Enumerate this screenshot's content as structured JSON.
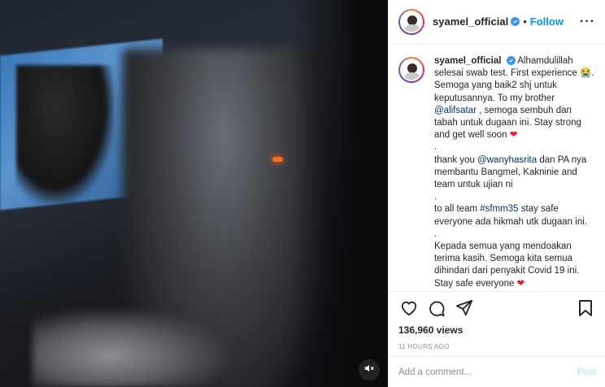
{
  "post": {
    "username": "syamel_official",
    "follow_label": "Follow",
    "more_icon": "more-horizontal-icon",
    "dot": "•"
  },
  "caption": {
    "username": "syamel_official",
    "lines": [
      "Alhamdulillah",
      "selesai swab test. First experience 😭.",
      "Semoga yang baik2 shj untuk",
      "keputusannya. To my brother",
      "@alifsatar",
      ", semoga sembuh dan",
      "tabah untuk dugaan ini. Stay strong",
      "and get well soon",
      ".",
      "thank you",
      "@wanyhasrita",
      "dan PA nya",
      "membantu Bangmel, Kakninie and",
      "team untuk ujian ni",
      ".",
      "to all team",
      "#sfmm35",
      "stay safe",
      "everyone ada hikmah utk dugaan ini.",
      ".",
      "Kepada semua yang mendoakan",
      "terima kasih. Semoga kita semua",
      "dihindari dari penyakit Covid 19 ini.",
      "Stay safe everyone",
      "."
    ],
    "heart": "❤"
  },
  "actions": {
    "like_icon": "heart-icon",
    "comment_icon": "comment-icon",
    "share_icon": "share-icon",
    "save_icon": "bookmark-icon",
    "views": "136,960 views",
    "time_ago": "11 HOURS AGO"
  },
  "comment_box": {
    "placeholder": "Add a comment...",
    "post_label": "Post"
  },
  "video": {
    "mute_icon": "speaker-muted-icon"
  }
}
